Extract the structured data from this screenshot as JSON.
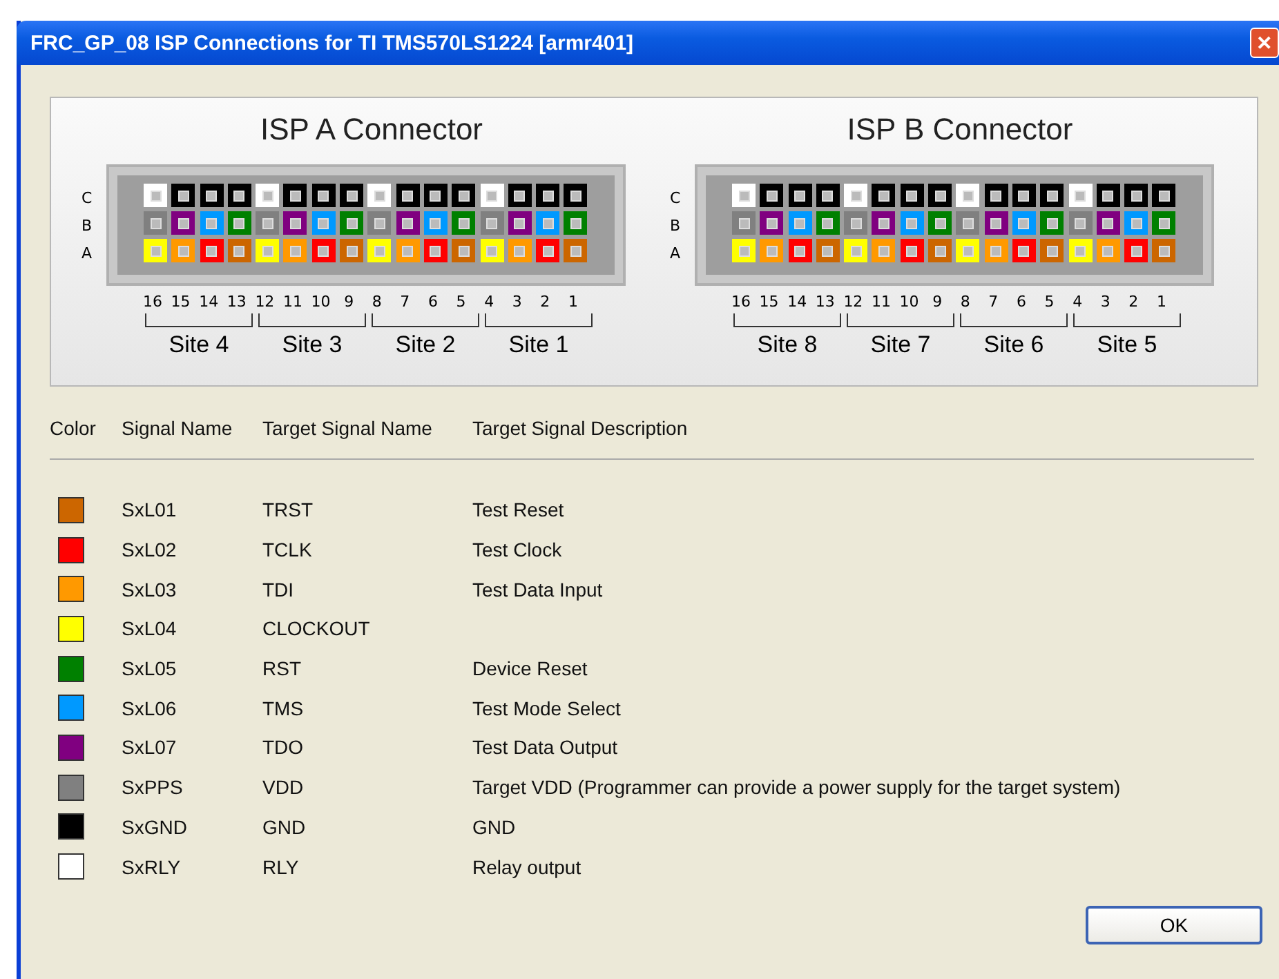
{
  "window": {
    "title": "FRC_GP_08 ISP Connections for TI TMS570LS1224 [armr401]",
    "close_icon": "✕"
  },
  "connectors": [
    {
      "title": "ISP A Connector",
      "rows": [
        {
          "label": "C",
          "pins": [
            {
              "color": "#ffffff"
            },
            {
              "color": "#000000"
            },
            {
              "color": "#000000"
            },
            {
              "color": "#000000"
            },
            {
              "color": "#ffffff"
            },
            {
              "color": "#000000"
            },
            {
              "color": "#000000"
            },
            {
              "color": "#000000"
            },
            {
              "color": "#ffffff"
            },
            {
              "color": "#000000"
            },
            {
              "color": "#000000"
            },
            {
              "color": "#000000"
            },
            {
              "color": "#ffffff"
            },
            {
              "color": "#000000"
            },
            {
              "color": "#000000"
            },
            {
              "color": "#000000"
            }
          ]
        },
        {
          "label": "B",
          "pins": [
            {
              "color": "#808080"
            },
            {
              "color": "#800080"
            },
            {
              "color": "#0099ff"
            },
            {
              "color": "#008000"
            },
            {
              "color": "#808080"
            },
            {
              "color": "#800080"
            },
            {
              "color": "#0099ff"
            },
            {
              "color": "#008000"
            },
            {
              "color": "#808080"
            },
            {
              "color": "#800080"
            },
            {
              "color": "#0099ff"
            },
            {
              "color": "#008000"
            },
            {
              "color": "#808080"
            },
            {
              "color": "#800080"
            },
            {
              "color": "#0099ff"
            },
            {
              "color": "#008000"
            }
          ]
        },
        {
          "label": "A",
          "pins": [
            {
              "color": "#ffff00"
            },
            {
              "color": "#ff9900"
            },
            {
              "color": "#ff0000"
            },
            {
              "color": "#cc6600"
            },
            {
              "color": "#ffff00"
            },
            {
              "color": "#ff9900"
            },
            {
              "color": "#ff0000"
            },
            {
              "color": "#cc6600"
            },
            {
              "color": "#ffff00"
            },
            {
              "color": "#ff9900"
            },
            {
              "color": "#ff0000"
            },
            {
              "color": "#cc6600"
            },
            {
              "color": "#ffff00"
            },
            {
              "color": "#ff9900"
            },
            {
              "color": "#ff0000"
            },
            {
              "color": "#cc6600"
            }
          ]
        }
      ],
      "pin_numbers": [
        "16",
        "15",
        "14",
        "13",
        "12",
        "11",
        "10",
        "9",
        "8",
        "7",
        "6",
        "5",
        "4",
        "3",
        "2",
        "1"
      ],
      "sites": [
        "Site 4",
        "Site 3",
        "Site 2",
        "Site 1"
      ]
    },
    {
      "title": "ISP B Connector",
      "rows": [
        {
          "label": "C",
          "pins": [
            {
              "color": "#ffffff"
            },
            {
              "color": "#000000"
            },
            {
              "color": "#000000"
            },
            {
              "color": "#000000"
            },
            {
              "color": "#ffffff"
            },
            {
              "color": "#000000"
            },
            {
              "color": "#000000"
            },
            {
              "color": "#000000"
            },
            {
              "color": "#ffffff"
            },
            {
              "color": "#000000"
            },
            {
              "color": "#000000"
            },
            {
              "color": "#000000"
            },
            {
              "color": "#ffffff"
            },
            {
              "color": "#000000"
            },
            {
              "color": "#000000"
            },
            {
              "color": "#000000"
            }
          ]
        },
        {
          "label": "B",
          "pins": [
            {
              "color": "#808080"
            },
            {
              "color": "#800080"
            },
            {
              "color": "#0099ff"
            },
            {
              "color": "#008000"
            },
            {
              "color": "#808080"
            },
            {
              "color": "#800080"
            },
            {
              "color": "#0099ff"
            },
            {
              "color": "#008000"
            },
            {
              "color": "#808080"
            },
            {
              "color": "#800080"
            },
            {
              "color": "#0099ff"
            },
            {
              "color": "#008000"
            },
            {
              "color": "#808080"
            },
            {
              "color": "#800080"
            },
            {
              "color": "#0099ff"
            },
            {
              "color": "#008000"
            }
          ]
        },
        {
          "label": "A",
          "pins": [
            {
              "color": "#ffff00"
            },
            {
              "color": "#ff9900"
            },
            {
              "color": "#ff0000"
            },
            {
              "color": "#cc6600"
            },
            {
              "color": "#ffff00"
            },
            {
              "color": "#ff9900"
            },
            {
              "color": "#ff0000"
            },
            {
              "color": "#cc6600"
            },
            {
              "color": "#ffff00"
            },
            {
              "color": "#ff9900"
            },
            {
              "color": "#ff0000"
            },
            {
              "color": "#cc6600"
            },
            {
              "color": "#ffff00"
            },
            {
              "color": "#ff9900"
            },
            {
              "color": "#ff0000"
            },
            {
              "color": "#cc6600"
            }
          ]
        }
      ],
      "pin_numbers": [
        "16",
        "15",
        "14",
        "13",
        "12",
        "11",
        "10",
        "9",
        "8",
        "7",
        "6",
        "5",
        "4",
        "3",
        "2",
        "1"
      ],
      "sites": [
        "Site 8",
        "Site 7",
        "Site 6",
        "Site 5"
      ]
    }
  ],
  "legend": {
    "columns": [
      "Color",
      "Signal Name",
      "Target Signal Name",
      "Target Signal Description"
    ],
    "rows": [
      {
        "color": "#cc6600",
        "signal": "SxL01",
        "target": "TRST",
        "description": "Test Reset"
      },
      {
        "color": "#ff0000",
        "signal": "SxL02",
        "target": "TCLK",
        "description": "Test Clock"
      },
      {
        "color": "#ff9900",
        "signal": "SxL03",
        "target": "TDI",
        "description": "Test Data Input"
      },
      {
        "color": "#ffff00",
        "signal": "SxL04",
        "target": "CLOCKOUT"
      },
      {
        "color": "#008000",
        "signal": "SxL05",
        "target": "RST",
        "description": "Device Reset"
      },
      {
        "color": "#0099ff",
        "signal": "SxL06",
        "target": "TMS",
        "description": "Test Mode Select"
      },
      {
        "color": "#800080",
        "signal": "SxL07",
        "target": "TDO",
        "description": "Test Data Output"
      },
      {
        "color": "#808080",
        "signal": "SxPPS",
        "target": "VDD",
        "description": "Target VDD (Programmer can provide a power supply for the target system)"
      },
      {
        "color": "#000000",
        "signal": "SxGND",
        "target": "GND",
        "description": "GND"
      },
      {
        "color": "#ffffff",
        "signal": "SxRLY",
        "target": "RLY",
        "description": "Relay output"
      }
    ]
  },
  "buttons": [
    "OK"
  ]
}
